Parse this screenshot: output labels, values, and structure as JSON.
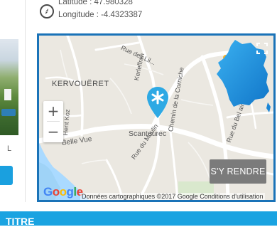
{
  "coordinates": {
    "latitude_text": "Latitude : 47.980328",
    "longitude_text": "Longitude : -4.4323387"
  },
  "left_column": {
    "partial_letter": "L"
  },
  "map": {
    "labels": {
      "kervoueret": "KERVOUËRET",
      "scantourec": "Scantourec",
      "belle_vue": "Belle Vue",
      "rue_du_moulin": "Rue du Moulin",
      "chemin_corniche": "Chemin de la Corniche",
      "rue_bel_air": "Rue du Bel air",
      "kerleffran": "Kerleffran",
      "hent_koz": "Hent Koz",
      "rue_des_lilas": "Rue des Lil..."
    },
    "zoom_in_label": "+",
    "zoom_out_label": "−",
    "go_button_label": "S'Y RENDRE",
    "credit_text": "Données cartographiques ©2017 Google   Conditions d'utilisation",
    "google_letters": [
      "G",
      "o",
      "o",
      "g",
      "l",
      "e"
    ],
    "google_colors": [
      "#4285f4",
      "#ea4335",
      "#fbbc05",
      "#4285f4",
      "#34a853",
      "#ea4335"
    ],
    "marker_color": "#2ea9e4",
    "border_color": "#1a73b8"
  },
  "bottom_banner": {
    "text": "TITRE",
    "color": "#1aa3e1"
  },
  "icons": {
    "compass": "compass-icon",
    "marker": "map-marker-icon",
    "fullscreen": "fullscreen-icon",
    "france": "france-map-icon"
  }
}
